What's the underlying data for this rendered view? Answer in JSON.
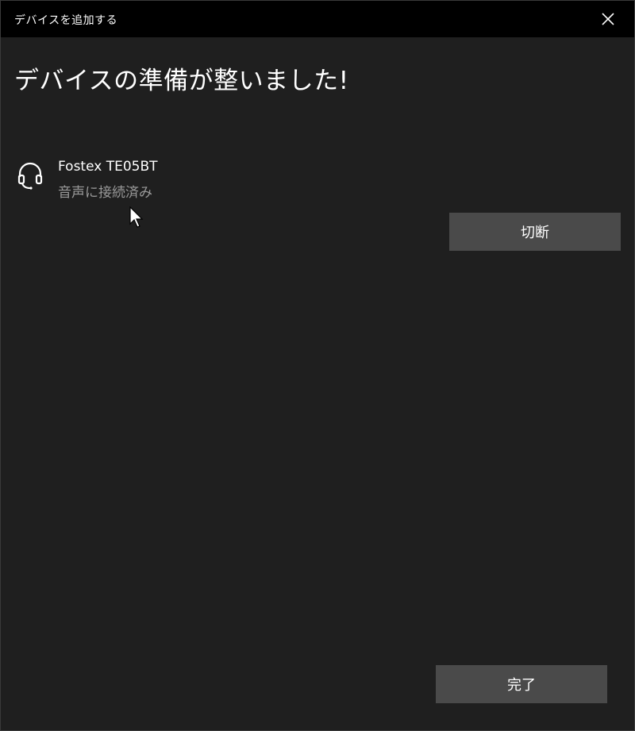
{
  "window": {
    "title": "デバイスを追加する",
    "close_icon": "close-icon"
  },
  "main": {
    "heading": "デバイスの準備が整いました!"
  },
  "device": {
    "icon": "headset-icon",
    "name": "Fostex TE05BT",
    "status": "音声に接続済み",
    "disconnect_label": "切断"
  },
  "footer": {
    "done_label": "完了"
  },
  "colors": {
    "titlebar_bg": "#000000",
    "window_bg": "#1f1f1f",
    "button_bg": "#4a4a4a",
    "text_primary": "#ffffff",
    "text_secondary": "#9a9a9a"
  }
}
